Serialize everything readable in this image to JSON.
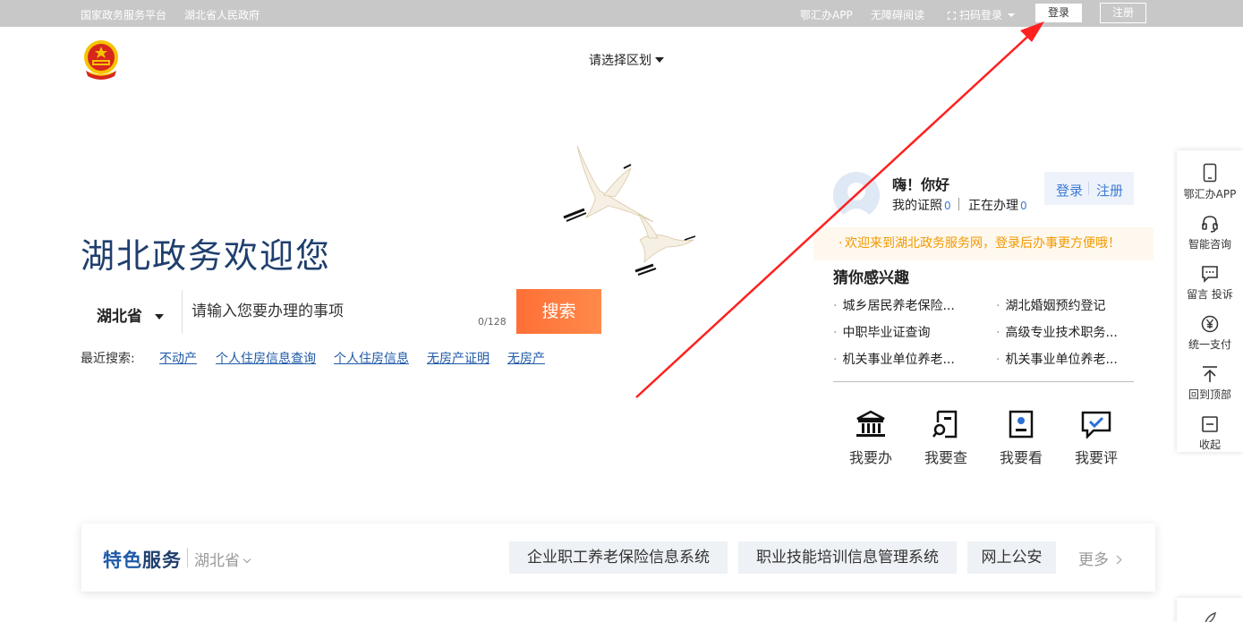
{
  "topbar": {
    "left_links": [
      "国家政务服务平台",
      "湖北省人民政府"
    ],
    "right_links": {
      "app": "鄂汇办APP",
      "accessible": "无障碍阅读",
      "scan_login": "扫码登录"
    },
    "login": "登录",
    "register": "注册"
  },
  "header": {
    "region_select": "请选择区划"
  },
  "hero": {
    "title": "湖北政务欢迎您"
  },
  "search": {
    "province": "湖北省",
    "placeholder": "请输入您要办理的事项",
    "count": "0/128",
    "button": "搜索",
    "recent_label": "最近搜索:",
    "recent": [
      "不动产",
      "个人住房信息查询",
      "个人住房信息",
      "无房产证明",
      "无房产"
    ]
  },
  "user_panel": {
    "greeting": "嗨！你好",
    "certificates_label": "我的证照",
    "certificates_count": "0",
    "processing_label": "正在办理",
    "processing_count": "0",
    "login": "登录",
    "register": "注册",
    "notice": "欢迎来到湖北政务服务网，登录后办事更方便哦！",
    "interest_title": "猜你感兴趣",
    "interests": [
      "城乡居民养老保险...",
      "湖北婚姻预约登记",
      "中职毕业证查询",
      "高级专业技术职务...",
      "机关事业单位养老...",
      "机关事业单位养老..."
    ],
    "quick_actions": [
      "我要办",
      "我要查",
      "我要看",
      "我要评"
    ]
  },
  "sidebar": {
    "items": [
      "鄂汇办APP",
      "智能咨询",
      "留言 投诉",
      "统一支付",
      "回到顶部",
      "收起"
    ]
  },
  "feature": {
    "title_part1": "特色",
    "title_part2": "服务",
    "province": "湖北省",
    "tags": [
      "企业职工养老保险信息系统",
      "职业技能培训信息管理系统",
      "网上公安"
    ],
    "more": "更多"
  },
  "colors": {
    "brand_blue": "#1f5aa8",
    "title_navy": "#1f3f6e",
    "search_orange": "#ff7a3d",
    "annotation_red": "#ff2020",
    "notice_orange": "#f29a00"
  }
}
